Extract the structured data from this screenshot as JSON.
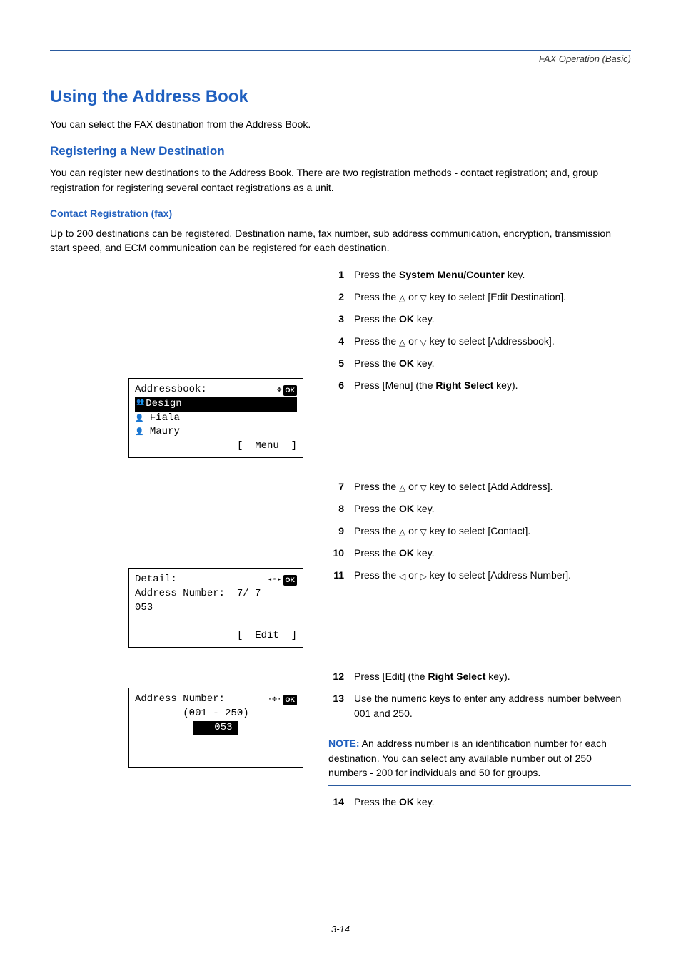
{
  "header": {
    "breadcrumb": "FAX Operation (Basic)"
  },
  "h1": "Using the Address Book",
  "p1": "You can select the FAX destination from the Address Book.",
  "h2": "Registering a New Destination",
  "p2": "You can register new destinations to the Address Book. There are two registration methods - contact registration; and, group registration for registering several contact registrations as a unit.",
  "h3": "Contact Registration (fax)",
  "p3": "Up to 200 destinations can be registered. Destination name, fax number, sub address communication, encryption, transmission start speed, and ECM communication can be registered for each destination.",
  "steps": {
    "s1": {
      "n": "1",
      "pre": "Press the ",
      "bold": "System Menu/Counter",
      "post": " key."
    },
    "s2": {
      "n": "2",
      "pre": "Press the ",
      "mid": " or ",
      "post": " key to select [Edit Destination]."
    },
    "s3": {
      "n": "3",
      "pre": "Press the ",
      "bold": "OK",
      "post": " key."
    },
    "s4": {
      "n": "4",
      "pre": "Press the ",
      "mid": " or ",
      "post": " key to select [Addressbook]."
    },
    "s5": {
      "n": "5",
      "pre": "Press the ",
      "bold": "OK",
      "post": " key."
    },
    "s6": {
      "n": "6",
      "pre": "Press [Menu] (the ",
      "bold": "Right Select",
      "post": " key)."
    },
    "s7": {
      "n": "7",
      "pre": "Press the ",
      "mid": " or ",
      "post": " key to select [Add Address]."
    },
    "s8": {
      "n": "8",
      "pre": "Press the ",
      "bold": "OK",
      "post": " key."
    },
    "s9": {
      "n": "9",
      "pre": "Press the ",
      "mid": " or ",
      "post": " key to select [Contact]."
    },
    "s10": {
      "n": "10",
      "pre": "Press the ",
      "bold": "OK",
      "post": " key."
    },
    "s11": {
      "n": "11",
      "pre": "Press the ",
      "mid": " or ",
      "post": " key to select [Address Number]."
    },
    "s12": {
      "n": "12",
      "pre": "Press [Edit] (the ",
      "bold": "Right Select",
      "post": " key)."
    },
    "s13": {
      "n": "13",
      "text": "Use the numeric keys to enter any address number between 001 and 250."
    },
    "s14": {
      "n": "14",
      "pre": "Press the ",
      "bold": "OK",
      "post": " key."
    }
  },
  "lcd1": {
    "title": "Addressbook:",
    "ok": "OK",
    "row1": "Design",
    "row2": "Fiala",
    "row3": "Maury",
    "soft": "[  Menu  ]"
  },
  "lcd2": {
    "title": "Detail:",
    "ok": "OK",
    "row1": "Address Number:  7/ 7",
    "row2": "053",
    "soft": "[  Edit  ]"
  },
  "lcd3": {
    "title": "Address Number:",
    "ok": "OK",
    "range": "(001 - 250)",
    "value": "053"
  },
  "note": {
    "label": "NOTE:",
    "text": " An address number is an identification number for each destination. You can select any available number out of 250 numbers - 200 for individuals and 50 for groups."
  },
  "pagenum": "3-14"
}
